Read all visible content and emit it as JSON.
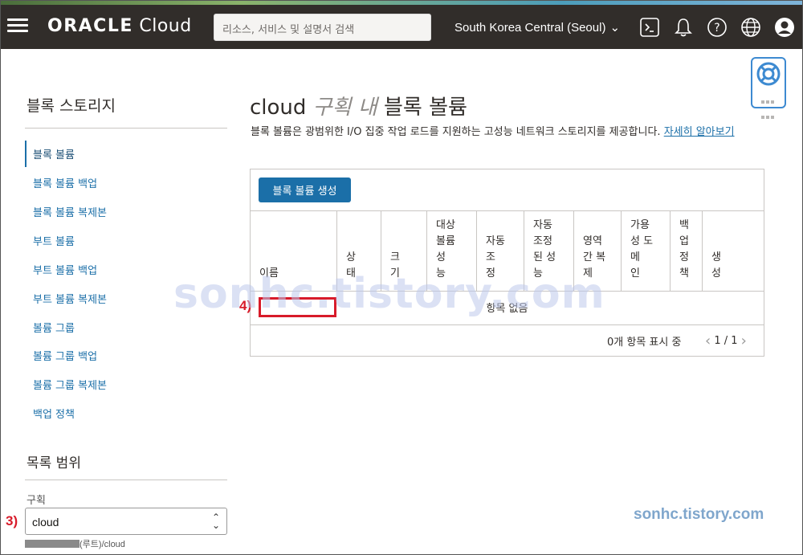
{
  "header": {
    "logo_main": "ORACLE",
    "logo_sub": " Cloud",
    "search_placeholder": "리소스, 서비스 및 설명서 검색",
    "region": "South Korea Central (Seoul)",
    "icons": [
      "hamburger-menu-icon",
      "cloud-shell-icon",
      "bell-icon",
      "help-icon",
      "globe-icon",
      "profile-icon"
    ]
  },
  "sidebar": {
    "title": "블록 스토리지",
    "items": [
      {
        "label": "블록 볼륨",
        "active": true
      },
      {
        "label": "블록 볼륨 백업"
      },
      {
        "label": "블록 볼륨 복제본"
      },
      {
        "label": "부트 볼륨"
      },
      {
        "label": "부트 볼륨 백업"
      },
      {
        "label": "부트 볼륨 복제본"
      },
      {
        "label": "볼륨 그룹"
      },
      {
        "label": "볼륨 그룹 백업"
      },
      {
        "label": "볼륨 그룹 복제본"
      },
      {
        "label": "백업 정책"
      }
    ],
    "scope_title": "목록 범위",
    "compartment_label": "구획",
    "compartment_value": "cloud",
    "compartment_path": "(루트)/cloud"
  },
  "main": {
    "title_compartment": "cloud",
    "title_mid": "구획 내",
    "title_rest": "블록 볼륨",
    "description": "블록 볼륨은 광범위한 I/O 집중 작업 로드를 지원하는 고성능 네트워크 스토리지를 제공합니다. ",
    "learn_more": "자세히 알아보기",
    "create_button": "블록 볼륨 생성",
    "columns": [
      {
        "label": "이름"
      },
      {
        "label": "상\n태"
      },
      {
        "label": "크\n기"
      },
      {
        "label": "대상\n볼륨\n성\n능"
      },
      {
        "label": "자동\n조\n정"
      },
      {
        "label": "자동\n조정\n된 성\n능"
      },
      {
        "label": "영역\n간 복\n제"
      },
      {
        "label": "가용\n성 도\n메\n인"
      },
      {
        "label": "백\n업\n정\n책"
      },
      {
        "label": "생\n성"
      }
    ],
    "empty_message": "항목 없음",
    "item_count": "0개 항목 표시 중",
    "page_indicator": "1 / 1"
  },
  "annotations": {
    "a3": "3)",
    "a4": "4)"
  },
  "watermark": {
    "big": "sonhc.tistory.com",
    "small": "sonhc.tistory.com"
  },
  "colors": {
    "navbar": "#312d2a",
    "link": "#1b6fa8",
    "primary_button": "#1b6fa8",
    "annotation_red": "#d81b2a"
  }
}
